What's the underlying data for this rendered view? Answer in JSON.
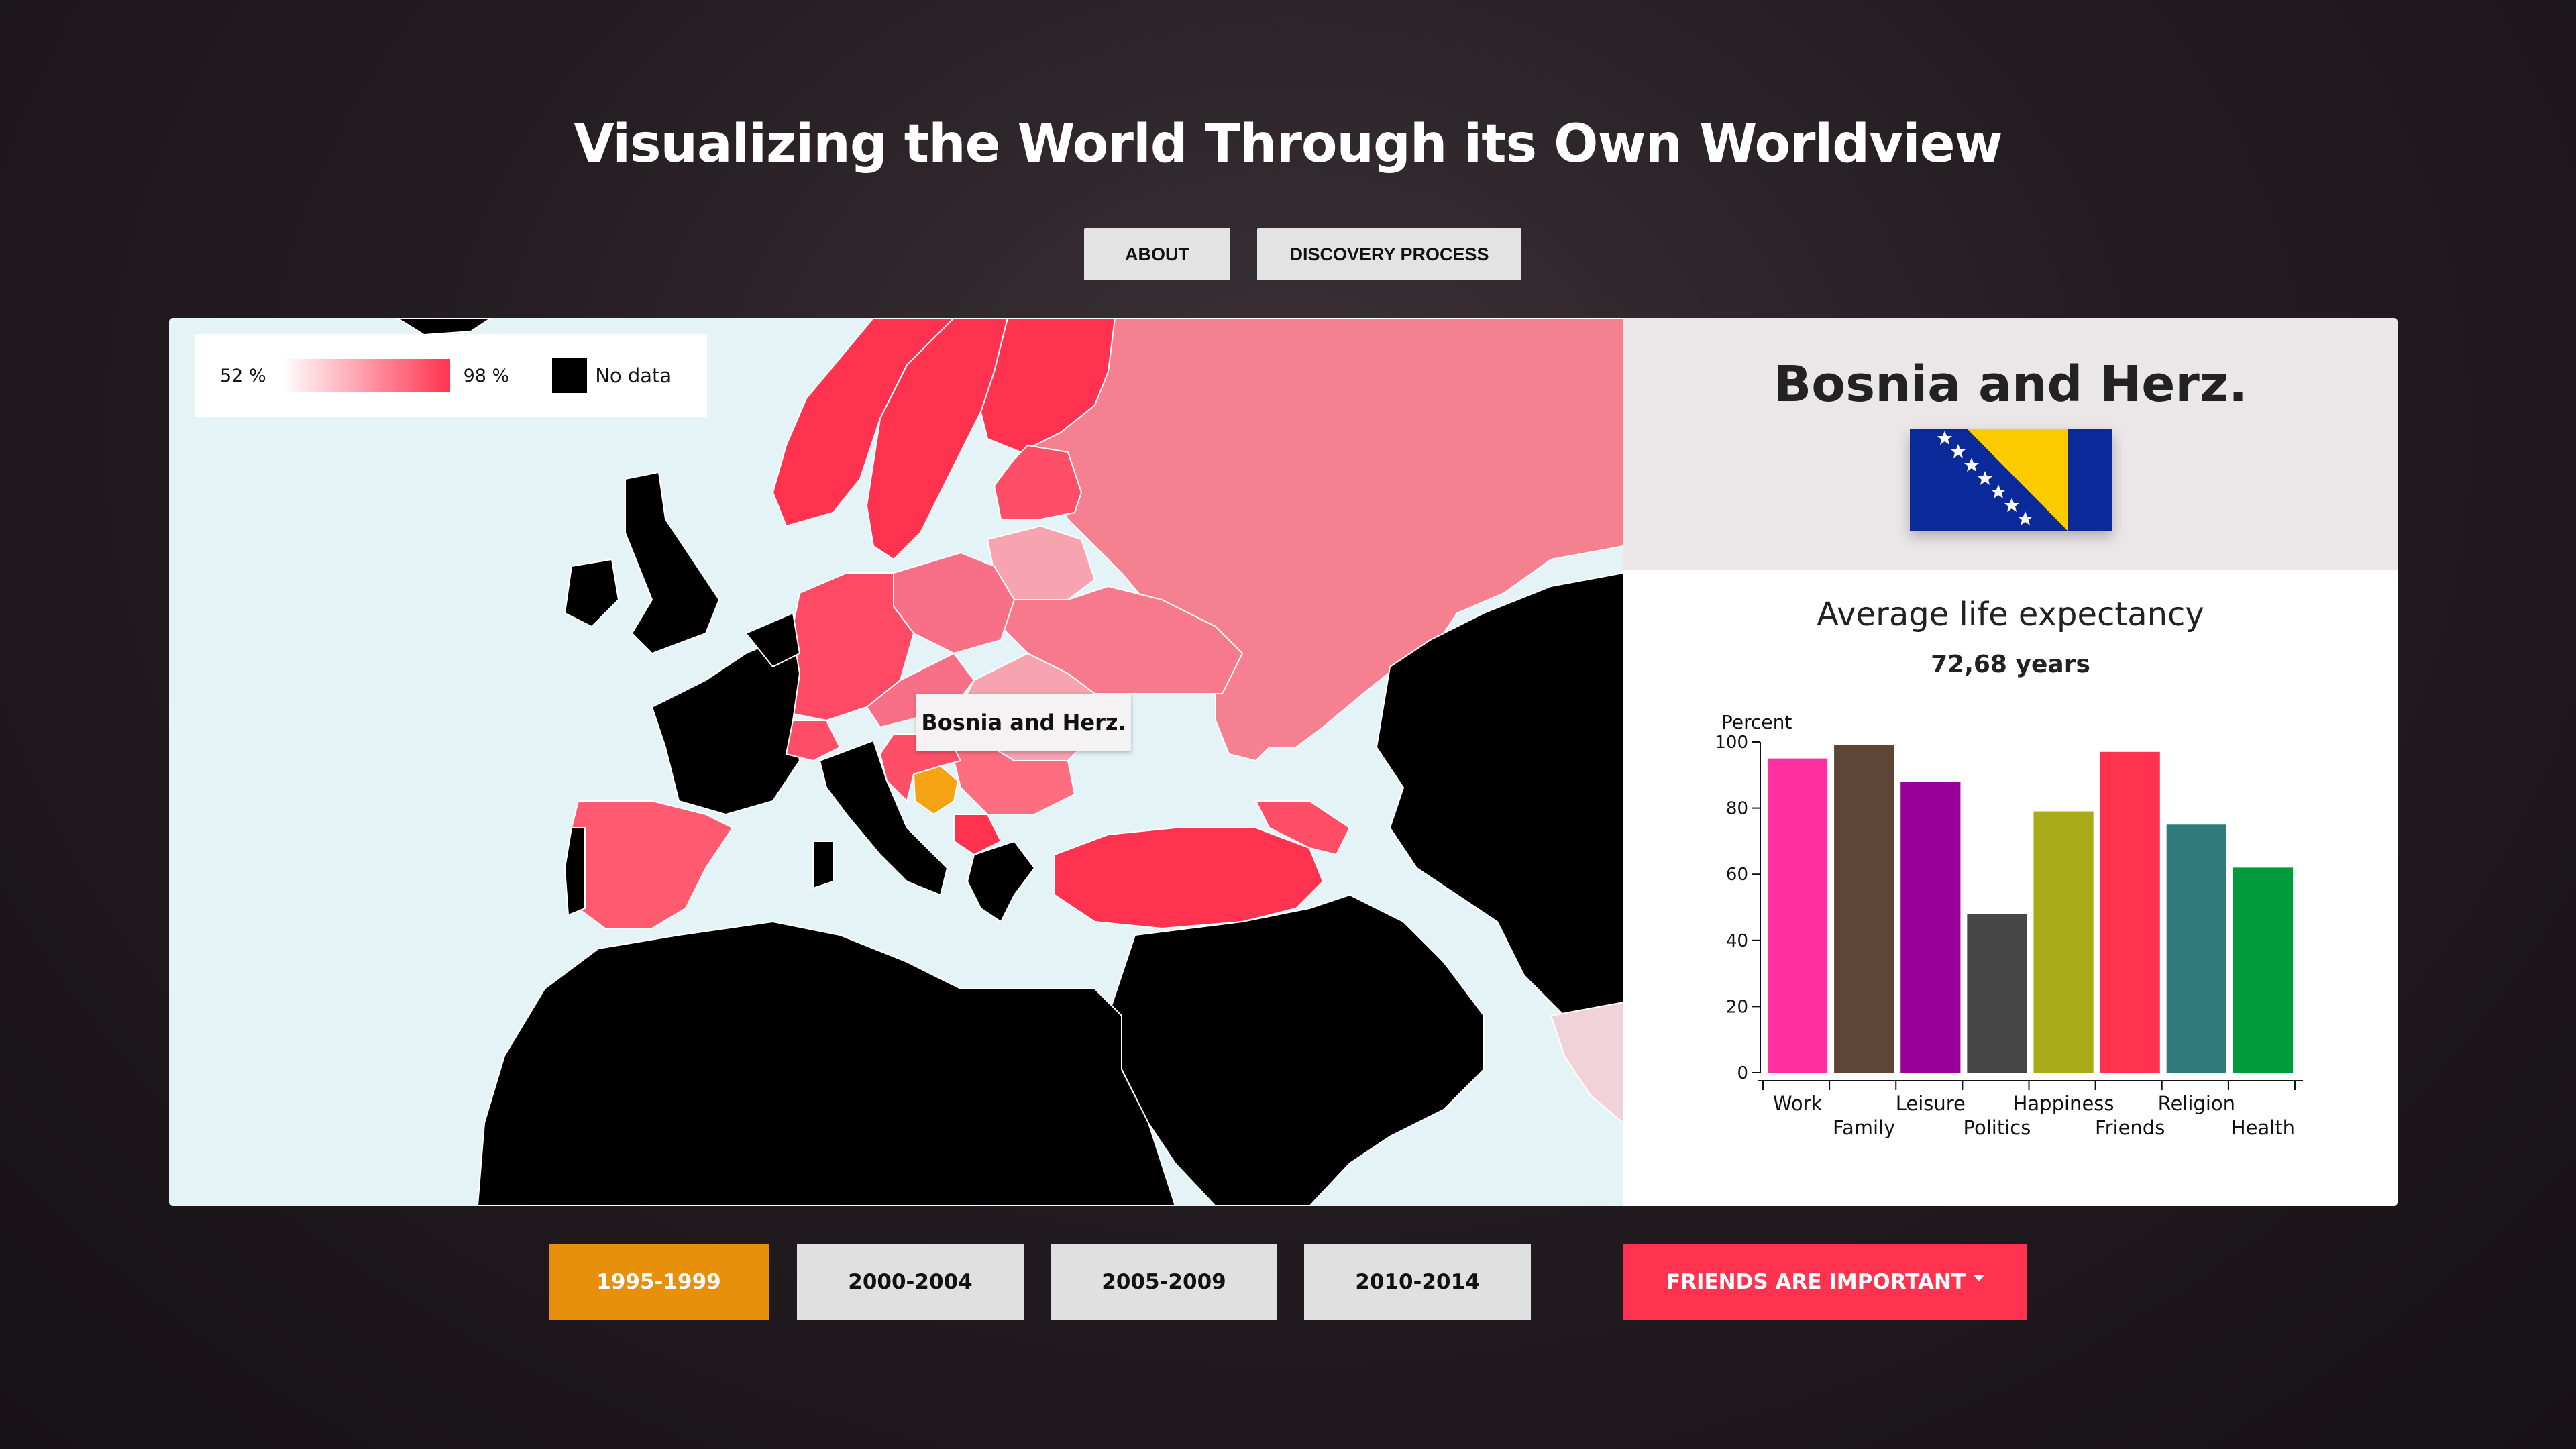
{
  "header": {
    "title": "Visualizing the World Through its Own Worldview",
    "about_label": "ABOUT",
    "discovery_label": "DISCOVERY PROCESS"
  },
  "legend": {
    "min_label": "52 %",
    "max_label": "98 %",
    "no_data_label": "No data",
    "gradient_start": "#ffffff",
    "gradient_end": "#ff3350",
    "no_data_color": "#000000"
  },
  "map": {
    "tooltip": "Bosnia and Herz.",
    "selected_color": "#f5a312",
    "ocean_color": "#e4f3f6"
  },
  "panel": {
    "country_name": "Bosnia and Herz.",
    "flag_icon": "bosnia-flag",
    "chart_title": "Average life expectancy",
    "chart_subtitle": "72,68 years"
  },
  "chart_data": {
    "type": "bar",
    "ylabel": "Percent",
    "ylim": [
      0,
      100
    ],
    "yticks": [
      0,
      20,
      40,
      60,
      80,
      100
    ],
    "categories": [
      "Work",
      "Family",
      "Leisure",
      "Politics",
      "Happiness",
      "Friends",
      "Religion",
      "Health"
    ],
    "values": [
      95,
      99,
      88,
      48,
      79,
      97,
      75,
      62
    ],
    "colors": [
      "#ff2fa0",
      "#5e4636",
      "#990099",
      "#474747",
      "#a9ab18",
      "#ff3350",
      "#2f7b7b",
      "#009b3a"
    ]
  },
  "periods": [
    {
      "label": "1995-1999",
      "active": true
    },
    {
      "label": "2000-2004",
      "active": false
    },
    {
      "label": "2005-2009",
      "active": false
    },
    {
      "label": "2010-2014",
      "active": false
    }
  ],
  "dropdown": {
    "label": "FRIENDS ARE IMPORTANT",
    "color": "#ff3350"
  }
}
